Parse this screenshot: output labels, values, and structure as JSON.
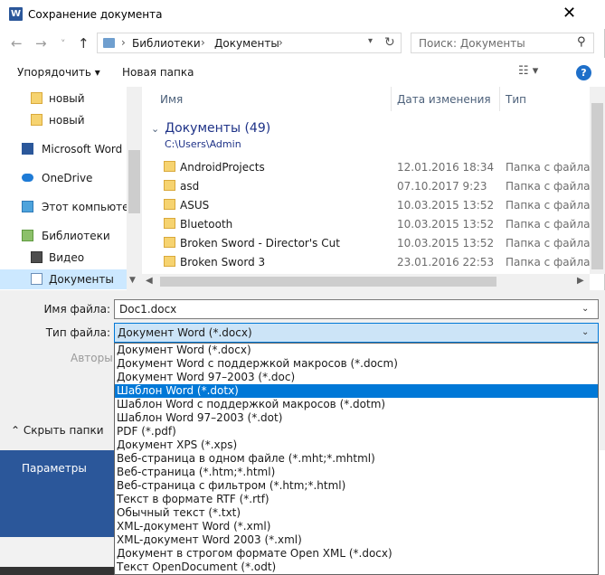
{
  "window": {
    "title": "Сохранение документа",
    "app_icon": "W"
  },
  "nav": {
    "back": "←",
    "forward": "→",
    "recent": "˅",
    "up": "↑"
  },
  "address": {
    "crumbs": [
      "Библиотеки",
      "Документы"
    ],
    "separator": "›"
  },
  "search": {
    "placeholder": "Поиск: Документы"
  },
  "toolbar": {
    "organize": "Упорядочить ▾",
    "new_folder": "Новая папка",
    "views": "☷ ▾",
    "help": "?"
  },
  "sidebar": {
    "items": [
      {
        "label": "новый",
        "icon": "folder"
      },
      {
        "label": "новый",
        "icon": "folder"
      },
      {
        "label": "Microsoft Word",
        "icon": "word"
      },
      {
        "label": "OneDrive",
        "icon": "cloud"
      },
      {
        "label": "Этот компьютер",
        "icon": "pc"
      },
      {
        "label": "Библиотеки",
        "icon": "library"
      },
      {
        "label": "Видео",
        "icon": "video"
      },
      {
        "label": "Документы",
        "icon": "document",
        "selected": true
      }
    ]
  },
  "files": {
    "columns": [
      "Имя",
      "Дата изменения",
      "Тип"
    ],
    "group": {
      "label": "Документы (49)",
      "path": "C:\\Users\\Admin"
    },
    "rows": [
      {
        "name": "AndroidProjects",
        "date": "12.01.2016 18:34",
        "type": "Папка с файлами"
      },
      {
        "name": "asd",
        "date": "07.10.2017 9:23",
        "type": "Папка с файлами"
      },
      {
        "name": "ASUS",
        "date": "10.03.2015 13:52",
        "type": "Папка с файлами"
      },
      {
        "name": "Bluetooth",
        "date": "10.03.2015 13:52",
        "type": "Папка с файлами"
      },
      {
        "name": "Broken Sword - Director's Cut",
        "date": "10.03.2015 13:52",
        "type": "Папка с файлами"
      },
      {
        "name": "Broken Sword 3",
        "date": "23.01.2016 22:53",
        "type": "Папка с файлами"
      }
    ]
  },
  "form": {
    "filename_label": "Имя файла:",
    "filename_value": "Doc1.docx",
    "filetype_label": "Тип файла:",
    "filetype_value": "Документ Word (*.docx)",
    "authors_label": "Авторы:",
    "hide_folders": "Скрыть папки"
  },
  "filetype_options": [
    "Документ Word (*.docx)",
    "Документ Word с поддержкой макросов (*.docm)",
    "Документ Word 97–2003 (*.doc)",
    "Шаблон Word (*.dotx)",
    "Шаблон Word с поддержкой макросов (*.dotm)",
    "Шаблон Word 97–2003 (*.dot)",
    "PDF (*.pdf)",
    "Документ XPS (*.xps)",
    "Веб-страница в одном файле (*.mht;*.mhtml)",
    "Веб-страница (*.htm;*.html)",
    "Веб-страница с фильтром (*.htm;*.html)",
    "Текст в формате RTF (*.rtf)",
    "Обычный текст (*.txt)",
    "XML-документ Word (*.xml)",
    "XML-документ Word 2003 (*.xml)",
    "Документ в строгом формате Open XML (*.docx)",
    "Текст OpenDocument (*.odt)"
  ],
  "selected_option_index": 3,
  "backstage": {
    "params": "Параметры"
  },
  "colors": {
    "accent": "#0078d7",
    "word_blue": "#2b579a",
    "link": "#1e3287"
  }
}
